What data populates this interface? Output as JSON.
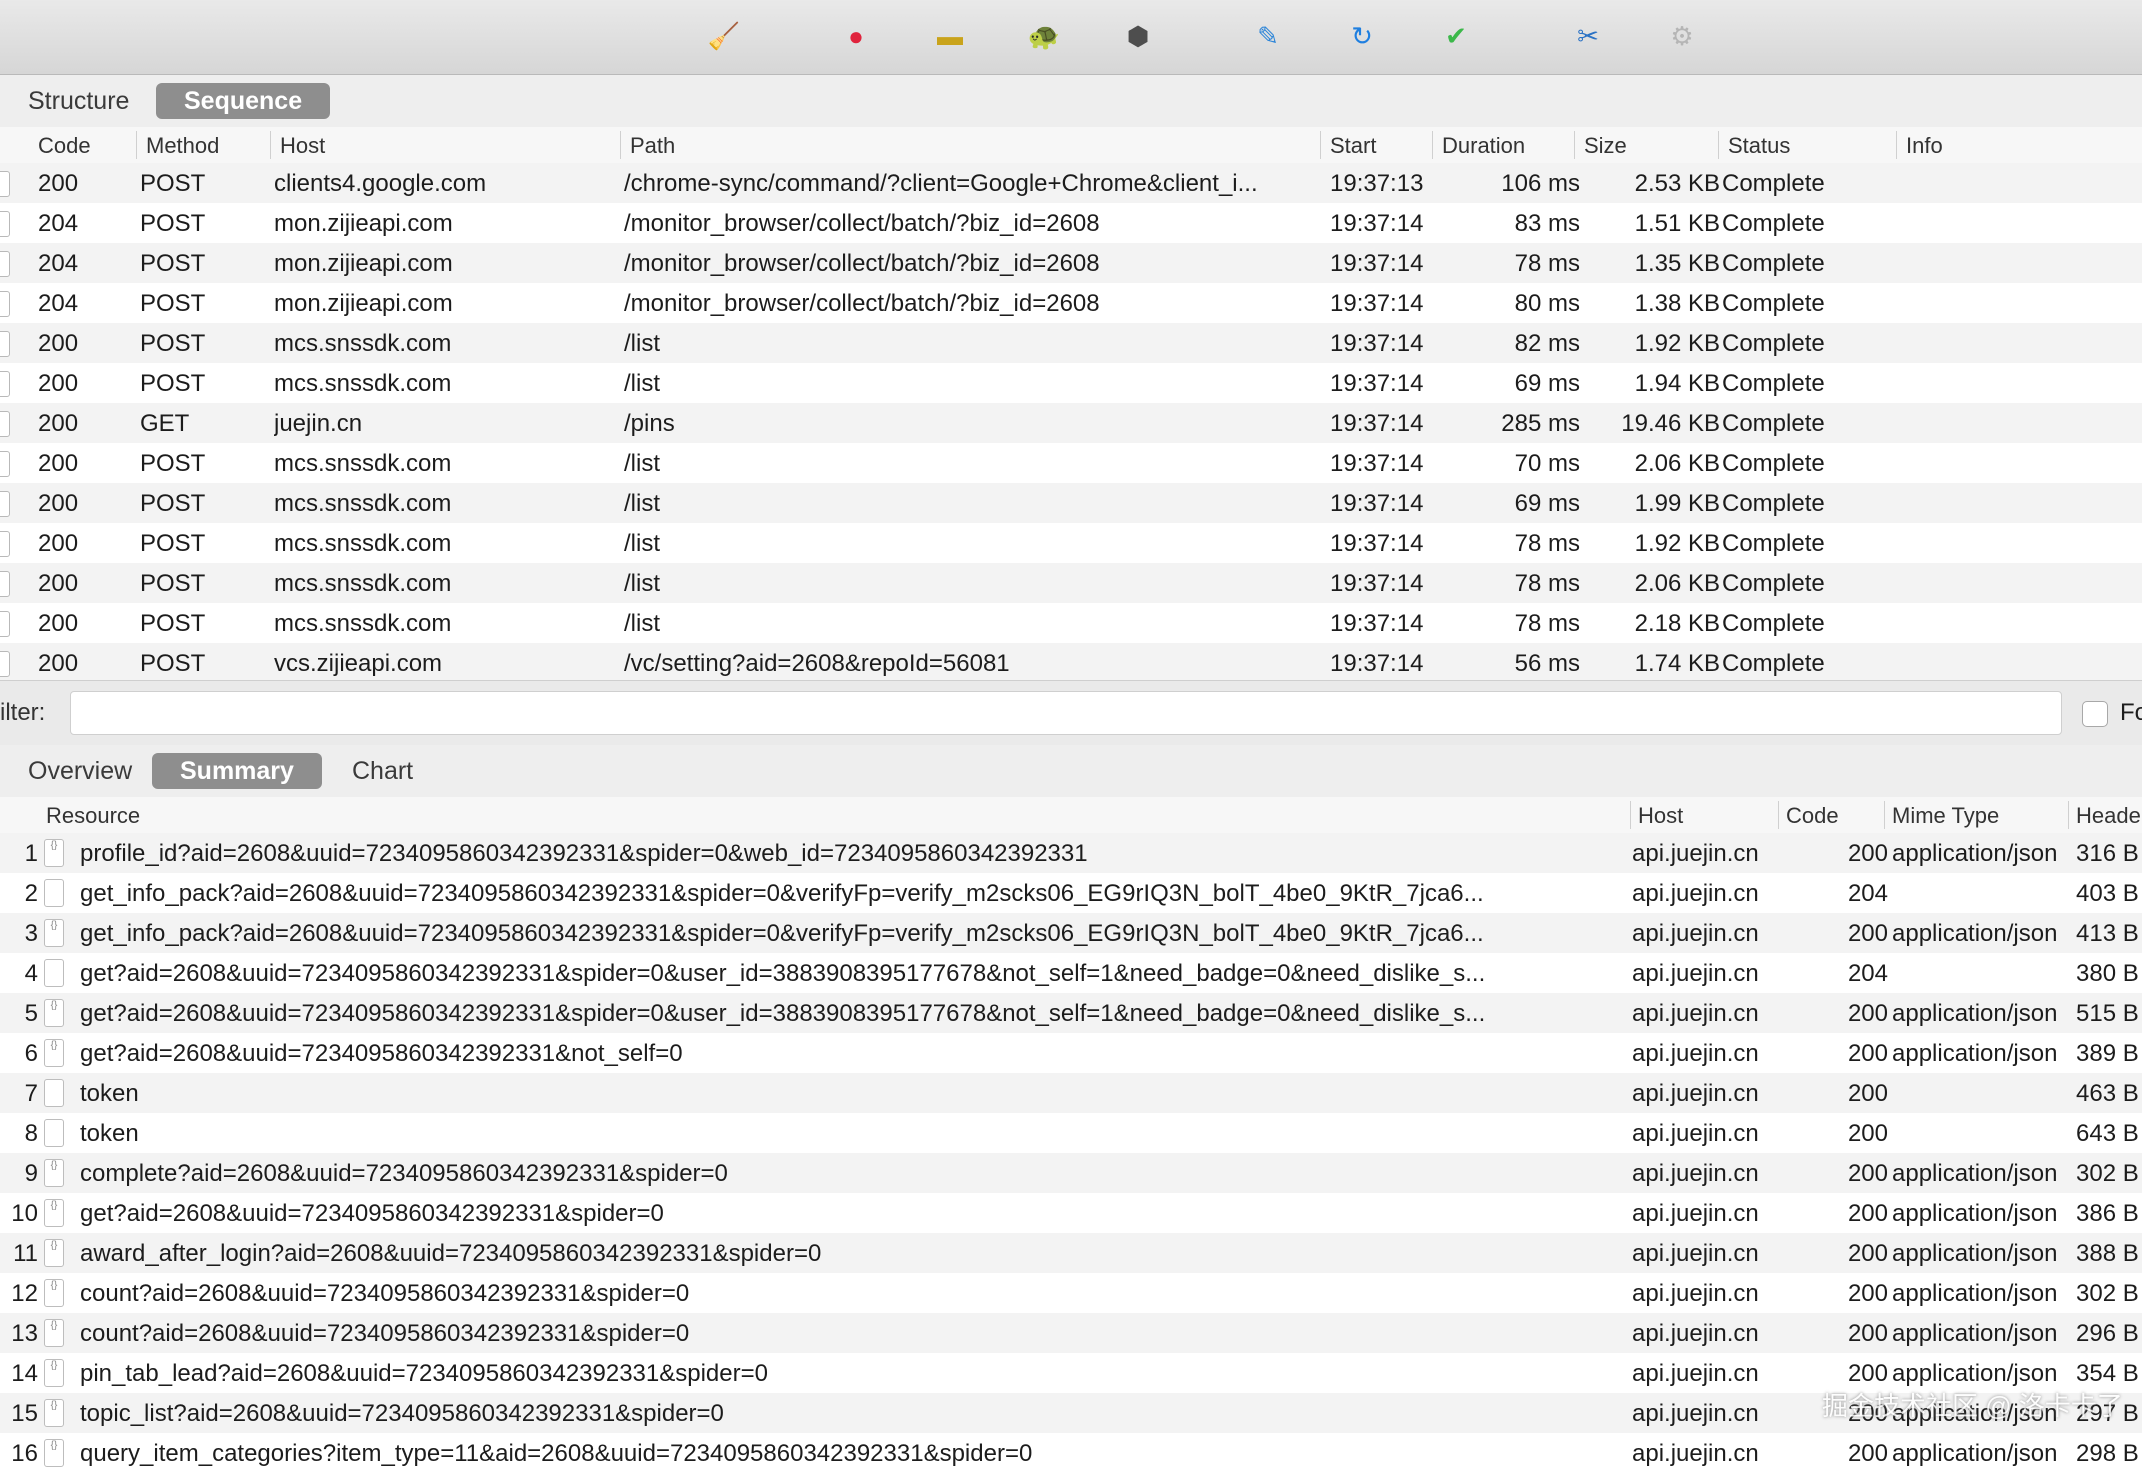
{
  "toolbar": {
    "tools": [
      {
        "name": "broom-icon",
        "glyph": "🧹",
        "color": "#d9a62a"
      },
      {
        "name": "record-icon",
        "glyph": "●",
        "color": "#e0243d"
      },
      {
        "name": "throttle-icon",
        "glyph": "▬",
        "color": "#c9a31b"
      },
      {
        "name": "turtle-icon",
        "glyph": "🐢",
        "color": "#5a5a5a"
      },
      {
        "name": "stop-icon",
        "glyph": "⬢",
        "color": "#4e4e4e"
      },
      {
        "name": "pen-icon",
        "glyph": "✎",
        "color": "#2f86d8"
      },
      {
        "name": "refresh-icon",
        "glyph": "↻",
        "color": "#1f7fe0"
      },
      {
        "name": "check-icon",
        "glyph": "✔",
        "color": "#3cb84a"
      },
      {
        "name": "tools-icon",
        "glyph": "✂",
        "color": "#2b72c4"
      },
      {
        "name": "gear-icon",
        "glyph": "⚙",
        "color": "#b5b5b5"
      }
    ]
  },
  "top_tabs": [
    {
      "label": "Structure",
      "active": false
    },
    {
      "label": "Sequence",
      "active": true
    }
  ],
  "request_columns": [
    "Code",
    "Method",
    "Host",
    "Path",
    "Start",
    "Duration",
    "Size",
    "Status",
    "Info"
  ],
  "requests": [
    {
      "code": "200",
      "method": "POST",
      "host": "clients4.google.com",
      "path": "/chrome-sync/command/?client=Google+Chrome&client_i...",
      "start": "19:37:13",
      "duration": "106 ms",
      "size": "2.53 KB",
      "status": "Complete",
      "info": ""
    },
    {
      "code": "204",
      "method": "POST",
      "host": "mon.zijieapi.com",
      "path": "/monitor_browser/collect/batch/?biz_id=2608",
      "start": "19:37:14",
      "duration": "83 ms",
      "size": "1.51 KB",
      "status": "Complete",
      "info": ""
    },
    {
      "code": "204",
      "method": "POST",
      "host": "mon.zijieapi.com",
      "path": "/monitor_browser/collect/batch/?biz_id=2608",
      "start": "19:37:14",
      "duration": "78 ms",
      "size": "1.35 KB",
      "status": "Complete",
      "info": ""
    },
    {
      "code": "204",
      "method": "POST",
      "host": "mon.zijieapi.com",
      "path": "/monitor_browser/collect/batch/?biz_id=2608",
      "start": "19:37:14",
      "duration": "80 ms",
      "size": "1.38 KB",
      "status": "Complete",
      "info": ""
    },
    {
      "code": "200",
      "method": "POST",
      "host": "mcs.snssdk.com",
      "path": "/list",
      "start": "19:37:14",
      "duration": "82 ms",
      "size": "1.92 KB",
      "status": "Complete",
      "info": ""
    },
    {
      "code": "200",
      "method": "POST",
      "host": "mcs.snssdk.com",
      "path": "/list",
      "start": "19:37:14",
      "duration": "69 ms",
      "size": "1.94 KB",
      "status": "Complete",
      "info": ""
    },
    {
      "code": "200",
      "method": "GET",
      "host": "juejin.cn",
      "path": "/pins",
      "start": "19:37:14",
      "duration": "285 ms",
      "size": "19.46 KB",
      "status": "Complete",
      "info": ""
    },
    {
      "code": "200",
      "method": "POST",
      "host": "mcs.snssdk.com",
      "path": "/list",
      "start": "19:37:14",
      "duration": "70 ms",
      "size": "2.06 KB",
      "status": "Complete",
      "info": ""
    },
    {
      "code": "200",
      "method": "POST",
      "host": "mcs.snssdk.com",
      "path": "/list",
      "start": "19:37:14",
      "duration": "69 ms",
      "size": "1.99 KB",
      "status": "Complete",
      "info": ""
    },
    {
      "code": "200",
      "method": "POST",
      "host": "mcs.snssdk.com",
      "path": "/list",
      "start": "19:37:14",
      "duration": "78 ms",
      "size": "1.92 KB",
      "status": "Complete",
      "info": ""
    },
    {
      "code": "200",
      "method": "POST",
      "host": "mcs.snssdk.com",
      "path": "/list",
      "start": "19:37:14",
      "duration": "78 ms",
      "size": "2.06 KB",
      "status": "Complete",
      "info": ""
    },
    {
      "code": "200",
      "method": "POST",
      "host": "mcs.snssdk.com",
      "path": "/list",
      "start": "19:37:14",
      "duration": "78 ms",
      "size": "2.18 KB",
      "status": "Complete",
      "info": ""
    },
    {
      "code": "200",
      "method": "POST",
      "host": "vcs.zijieapi.com",
      "path": "/vc/setting?aid=2608&repoId=56081",
      "start": "19:37:14",
      "duration": "56 ms",
      "size": "1.74 KB",
      "status": "Complete",
      "info": ""
    }
  ],
  "filter": {
    "label": "ilter:",
    "value": "",
    "checkbox_label": "Fo"
  },
  "bottom_tabs": [
    {
      "label": "Overview",
      "active": false
    },
    {
      "label": "Summary",
      "active": true
    },
    {
      "label": "Chart",
      "active": false
    }
  ],
  "summary_columns": [
    "Resource",
    "Host",
    "Code",
    "Mime Type",
    "Heade"
  ],
  "summary": [
    {
      "n": "1",
      "json": true,
      "resource": "profile_id?aid=2608&uuid=7234095860342392331&spider=0&web_id=7234095860342392331",
      "host": "api.juejin.cn",
      "code": "200",
      "mime": "application/json",
      "header": "316 B"
    },
    {
      "n": "2",
      "json": false,
      "resource": "get_info_pack?aid=2608&uuid=7234095860342392331&spider=0&verifyFp=verify_m2scks06_EG9rIQ3N_bolT_4be0_9KtR_7jca6...",
      "host": "api.juejin.cn",
      "code": "204",
      "mime": "",
      "header": "403 B"
    },
    {
      "n": "3",
      "json": true,
      "resource": "get_info_pack?aid=2608&uuid=7234095860342392331&spider=0&verifyFp=verify_m2scks06_EG9rIQ3N_bolT_4be0_9KtR_7jca6...",
      "host": "api.juejin.cn",
      "code": "200",
      "mime": "application/json",
      "header": "413 B"
    },
    {
      "n": "4",
      "json": false,
      "resource": "get?aid=2608&uuid=7234095860342392331&spider=0&user_id=3883908395177678&not_self=1&need_badge=0&need_dislike_s...",
      "host": "api.juejin.cn",
      "code": "204",
      "mime": "",
      "header": "380 B"
    },
    {
      "n": "5",
      "json": true,
      "resource": "get?aid=2608&uuid=7234095860342392331&spider=0&user_id=3883908395177678&not_self=1&need_badge=0&need_dislike_s...",
      "host": "api.juejin.cn",
      "code": "200",
      "mime": "application/json",
      "header": "515 B"
    },
    {
      "n": "6",
      "json": true,
      "resource": "get?aid=2608&uuid=7234095860342392331&not_self=0",
      "host": "api.juejin.cn",
      "code": "200",
      "mime": "application/json",
      "header": "389 B"
    },
    {
      "n": "7",
      "json": false,
      "resource": "token",
      "host": "api.juejin.cn",
      "code": "200",
      "mime": "",
      "header": "463 B"
    },
    {
      "n": "8",
      "json": false,
      "resource": "token",
      "host": "api.juejin.cn",
      "code": "200",
      "mime": "",
      "header": "643 B"
    },
    {
      "n": "9",
      "json": true,
      "resource": "complete?aid=2608&uuid=7234095860342392331&spider=0",
      "host": "api.juejin.cn",
      "code": "200",
      "mime": "application/json",
      "header": "302 B"
    },
    {
      "n": "10",
      "json": true,
      "resource": "get?aid=2608&uuid=7234095860342392331&spider=0",
      "host": "api.juejin.cn",
      "code": "200",
      "mime": "application/json",
      "header": "386 B"
    },
    {
      "n": "11",
      "json": true,
      "resource": "award_after_login?aid=2608&uuid=7234095860342392331&spider=0",
      "host": "api.juejin.cn",
      "code": "200",
      "mime": "application/json",
      "header": "388 B"
    },
    {
      "n": "12",
      "json": true,
      "resource": "count?aid=2608&uuid=7234095860342392331&spider=0",
      "host": "api.juejin.cn",
      "code": "200",
      "mime": "application/json",
      "header": "302 B"
    },
    {
      "n": "13",
      "json": true,
      "resource": "count?aid=2608&uuid=7234095860342392331&spider=0",
      "host": "api.juejin.cn",
      "code": "200",
      "mime": "application/json",
      "header": "296 B"
    },
    {
      "n": "14",
      "json": true,
      "resource": "pin_tab_lead?aid=2608&uuid=7234095860342392331&spider=0",
      "host": "api.juejin.cn",
      "code": "200",
      "mime": "application/json",
      "header": "354 B"
    },
    {
      "n": "15",
      "json": true,
      "resource": "topic_list?aid=2608&uuid=7234095860342392331&spider=0",
      "host": "api.juejin.cn",
      "code": "200",
      "mime": "application/json",
      "header": "297 B"
    },
    {
      "n": "16",
      "json": true,
      "resource": "query_item_categories?item_type=11&aid=2608&uuid=7234095860342392331&spider=0",
      "host": "api.juejin.cn",
      "code": "200",
      "mime": "application/json",
      "header": "298 B"
    }
  ],
  "watermark": "掘金技术社区 @ 洛卡卡了"
}
